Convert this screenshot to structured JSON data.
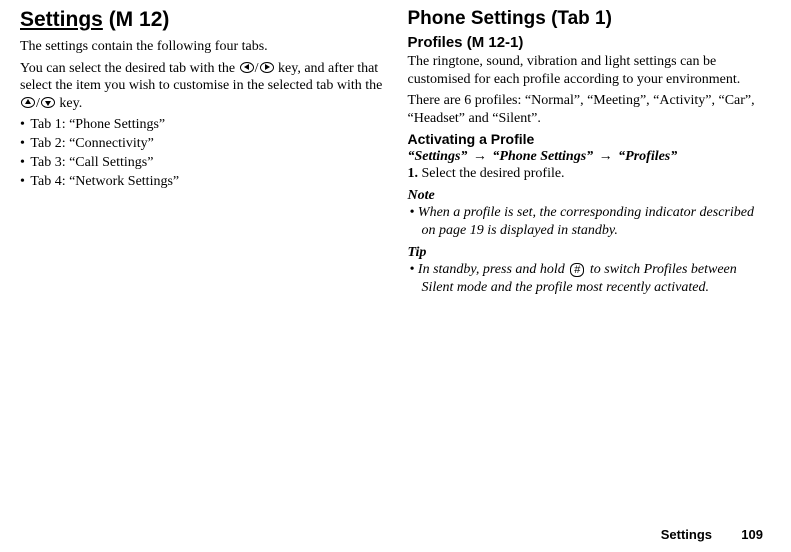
{
  "left": {
    "heading": "Settings",
    "menucode": "(M 12)",
    "intro": "The settings contain the following four tabs.",
    "keytext_pre": "You can select the desired tab with the ",
    "keytext_mid": " key, and after that select the item you wish to customise in the selected tab with the ",
    "keytext_post": " key.",
    "tabs": [
      "Tab 1: “Phone Settings”",
      "Tab 2: “Connectivity”",
      "Tab 3: “Call Settings”",
      "Tab 4: “Network Settings”"
    ]
  },
  "right": {
    "heading": "Phone Settings",
    "tabref": "(Tab 1)",
    "profiles_h": "Profiles",
    "profiles_code": "(M 12-1)",
    "profiles_intro": "The ringtone, sound, vibration and light settings can be customised for each profile according to your environment.",
    "profiles_list": "There are 6 profiles: “Normal”, “Meeting”, “Activity”, “Car”, “Headset” and “Silent”.",
    "activating_h": "Activating a Profile",
    "path_1": "“Settings”",
    "path_2": "“Phone Settings”",
    "path_3": "“Profiles”",
    "step_num": "1.",
    "step_text": "Select the desired profile.",
    "note_h": "Note",
    "note_body": "When a profile is set, the corresponding indicator described on page 19 is displayed in standby.",
    "tip_h": "Tip",
    "tip_pre": "In standby, press and hold ",
    "tip_key": "#",
    "tip_post": " to switch Profiles between Silent mode and the profile most recently activated."
  },
  "footer": {
    "section": "Settings",
    "page": "109"
  }
}
